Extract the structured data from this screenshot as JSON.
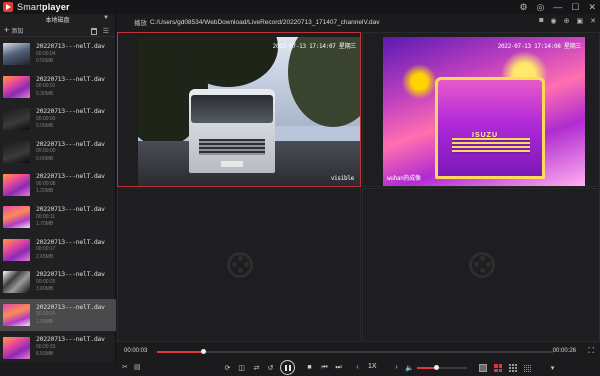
{
  "app": {
    "name_light": "Smart",
    "name_bold": "player"
  },
  "window_controls": [
    "⚙",
    "◎",
    "—",
    "☐",
    "✕"
  ],
  "sidebar": {
    "header": "本地磁盘",
    "add_label": "添加",
    "items": [
      {
        "name": "20220713---nelT.dav",
        "time": "00:00:04",
        "size": "0.55MB",
        "thumb": "street"
      },
      {
        "name": "20220713---nelT.dav",
        "time": "00:00:02",
        "size": "0.30MB",
        "thumb": "fire"
      },
      {
        "name": "20220713---nelT.dav",
        "time": "00:00:00",
        "size": "0.00MB",
        "thumb": "dark"
      },
      {
        "name": "20220713---nelT.dav",
        "time": "00:00:00",
        "size": "0.00MB",
        "thumb": "dark"
      },
      {
        "name": "20220713---nelT.dav",
        "time": "00:00:08",
        "size": "1.20MB",
        "thumb": "fire"
      },
      {
        "name": "20220713---nelT.dav",
        "time": "00:00:11",
        "size": "1.70MB",
        "thumb": "pink"
      },
      {
        "name": "20220713---nelT.dav",
        "time": "00:00:17",
        "size": "2.65MB",
        "thumb": "fire"
      },
      {
        "name": "20220713---nelT.dav",
        "time": "00:00:26",
        "size": "3.60MB",
        "thumb": "bw"
      },
      {
        "name": "20220713---nelT.dav",
        "time": "00:00:26",
        "size": "1.00MB",
        "thumb": "pink",
        "selected": true
      },
      {
        "name": "20220713---nelT.dav",
        "time": "00:00:33",
        "size": "6.50MB",
        "thumb": "fire"
      }
    ]
  },
  "path_bar": {
    "label": "播放",
    "path": "C:/Users/gd08534/WebDownload/LiveRecord/20220713_171407_channelV.dav",
    "icons": [
      "camera-icon",
      "record-icon",
      "zoom-icon",
      "ratio-icon",
      "close-icon"
    ]
  },
  "video": {
    "cell1_osd_top": "2022-07-13 17:14:07 星期三",
    "cell1_osd_bottom": "visible",
    "cell2_osd_top": "2022-07-13 17:14:08 星期三",
    "cell2_osd_bottom": "wuhan热成像",
    "cell2_brand": "ISUZU"
  },
  "playback": {
    "current_time": "00:00:03",
    "total_time": "00:00:26",
    "progress": 0.115,
    "speed": "1X",
    "volume": 0.37
  },
  "colors": {
    "accent": "#e0343c",
    "background": "#1b1b1d",
    "sidebar": "#202022"
  }
}
